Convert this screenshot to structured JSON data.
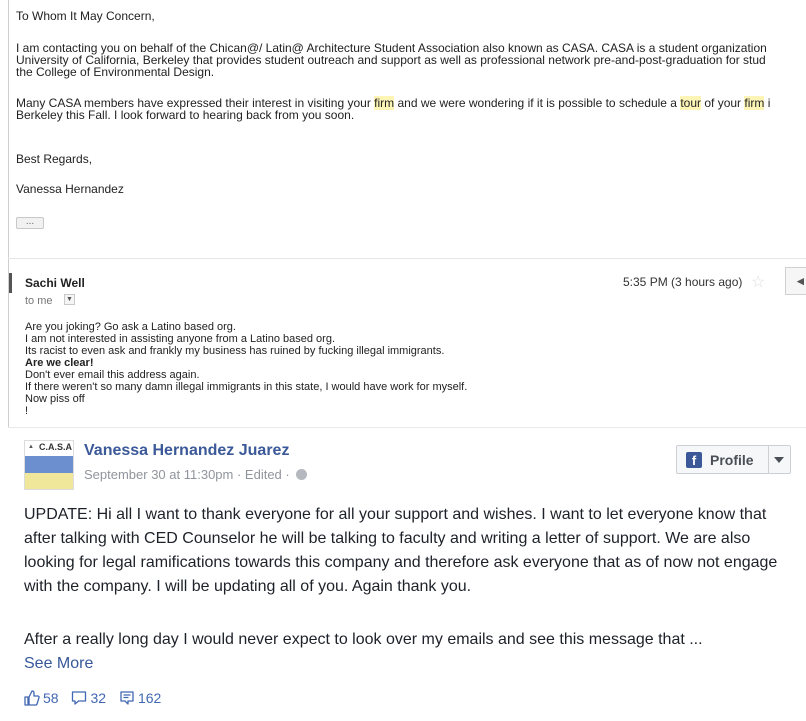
{
  "email": {
    "greeting": "To Whom It May Concern,",
    "para1_line1": "I am contacting you on behalf of the Chican@/ Latin@ Architecture Student Association also known as CASA. CASA is a student organization",
    "para1_line2": "University of California, Berkeley that provides student outreach and support as well as professional network pre-and-post-graduation for stud",
    "para1_line3": "the College of Environmental Design.",
    "para2_a": "Many CASA members have expressed their interest in visiting your ",
    "para2_hl1": "firm",
    "para2_b": " and we were wondering if it is possible to schedule a ",
    "para2_hl2": "tour",
    "para2_c": " of your ",
    "para2_hl3": "firm",
    "para2_d": " i",
    "para2_line2": "Berkeley this Fall. I look forward to hearing back from you soon.",
    "closing": "Best Regards,",
    "signature": "Vanessa Hernandez",
    "ellipsis": "..."
  },
  "reply": {
    "sender": "Sachi Well",
    "to": "to me",
    "time": "5:35 PM (3 hours ago)",
    "lines": [
      "Are you joking?  Go ask a Latino based org.",
      "I am not interested in assisting anyone from a Latino based org.",
      "Its racist to even ask and frankly my business has  ruined by fucking illegal immigrants.",
      "Are we clear!",
      "Don't ever email this address again.",
      "If there weren't so many damn illegal immigrants in this state, I would have work for myself.",
      "Now piss off",
      "!"
    ]
  },
  "post": {
    "avatar_logo": "C.A.S.A",
    "author": "Vanessa Hernandez Juarez",
    "date": "September 30 at 11:30pm",
    "sep": " · ",
    "edited": "Edited",
    "sep2": " · ",
    "profile_label": "Profile",
    "body": "UPDATE: Hi all I want to thank everyone for all your support and wishes. I want to let everyone know that after talking with CED Counselor he will be talking to faculty and writing a letter of support. We are also looking for legal ramifications towards this company and therefore ask everyone that as of now not engage with the company. I will be updating all of you. Again thank you.",
    "body2": "After a really long day I would never expect to look over my emails and see this message that ...",
    "see_more": "See More",
    "likes": "58",
    "comments": "32",
    "shares": "162"
  },
  "colors": {
    "fb_blue": "#3b5998",
    "link_blue": "#365899",
    "highlight": "#fdf5b6"
  }
}
